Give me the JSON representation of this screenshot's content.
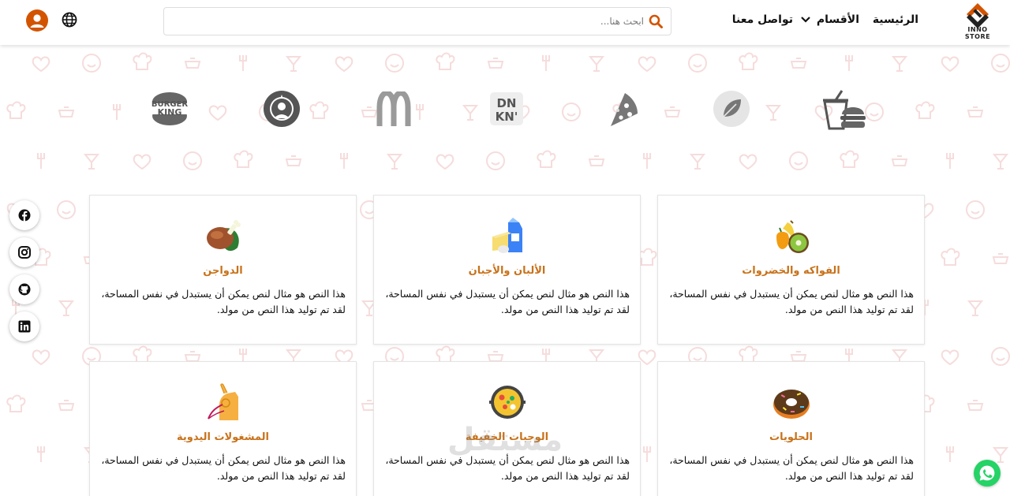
{
  "header": {
    "logo_text": "INNO STORE",
    "nav": {
      "home": "الرئيسية",
      "sections": "الأقسام",
      "contact": "تواصل معنا"
    },
    "search": {
      "placeholder": "ابحث هنا...",
      "value": ""
    }
  },
  "brands": [
    {
      "name": "burger-king",
      "label": "BURGER KING"
    },
    {
      "name": "starbucks",
      "label": ""
    },
    {
      "name": "mcdonalds",
      "label": ""
    },
    {
      "name": "dunkin",
      "label": "DN KN'"
    },
    {
      "name": "pizza",
      "label": ""
    },
    {
      "name": "leaf",
      "label": ""
    },
    {
      "name": "burger-box",
      "label": ""
    }
  ],
  "cards": [
    {
      "title": "الفواكه والخضروات",
      "desc": "هذا النص هو مثال لنص يمكن أن يستبدل في نفس المساحة، لقد تم توليد هذا النص من مولد.",
      "icon": "fruits-icon"
    },
    {
      "title": "الألبان والأجبان",
      "desc": "هذا النص هو مثال لنص يمكن أن يستبدل في نفس المساحة، لقد تم توليد هذا النص من مولد.",
      "icon": "dairy-icon"
    },
    {
      "title": "الدواجن",
      "desc": "هذا النص هو مثال لنص يمكن أن يستبدل في نفس المساحة، لقد تم توليد هذا النص من مولد.",
      "icon": "poultry-icon"
    },
    {
      "title": "الحلويات",
      "desc": "هذا النص هو مثال لنص يمكن أن يستبدل في نفس المساحة، لقد تم توليد هذا النص من مولد.",
      "icon": "donut-icon"
    },
    {
      "title": "الوجبات الخفيفة",
      "desc": "هذا النص هو مثال لنص يمكن أن يستبدل في نفس المساحة، لقد تم توليد هذا النص من مولد.",
      "icon": "snacks-icon"
    },
    {
      "title": "المشغولات اليدوية",
      "desc": "هذا النص هو مثال لنص يمكن أن يستبدل في نفس المساحة، لقد تم توليد هذا النص من مولد.",
      "icon": "handmade-icon"
    }
  ],
  "social": [
    "facebook-icon",
    "instagram-icon",
    "github-icon",
    "linkedin-icon"
  ],
  "watermark": "مستقل",
  "colors": {
    "accent": "#c8721a",
    "user": "#d35400",
    "whatsapp": "#25d366",
    "pattern": "#f6dcdc"
  }
}
